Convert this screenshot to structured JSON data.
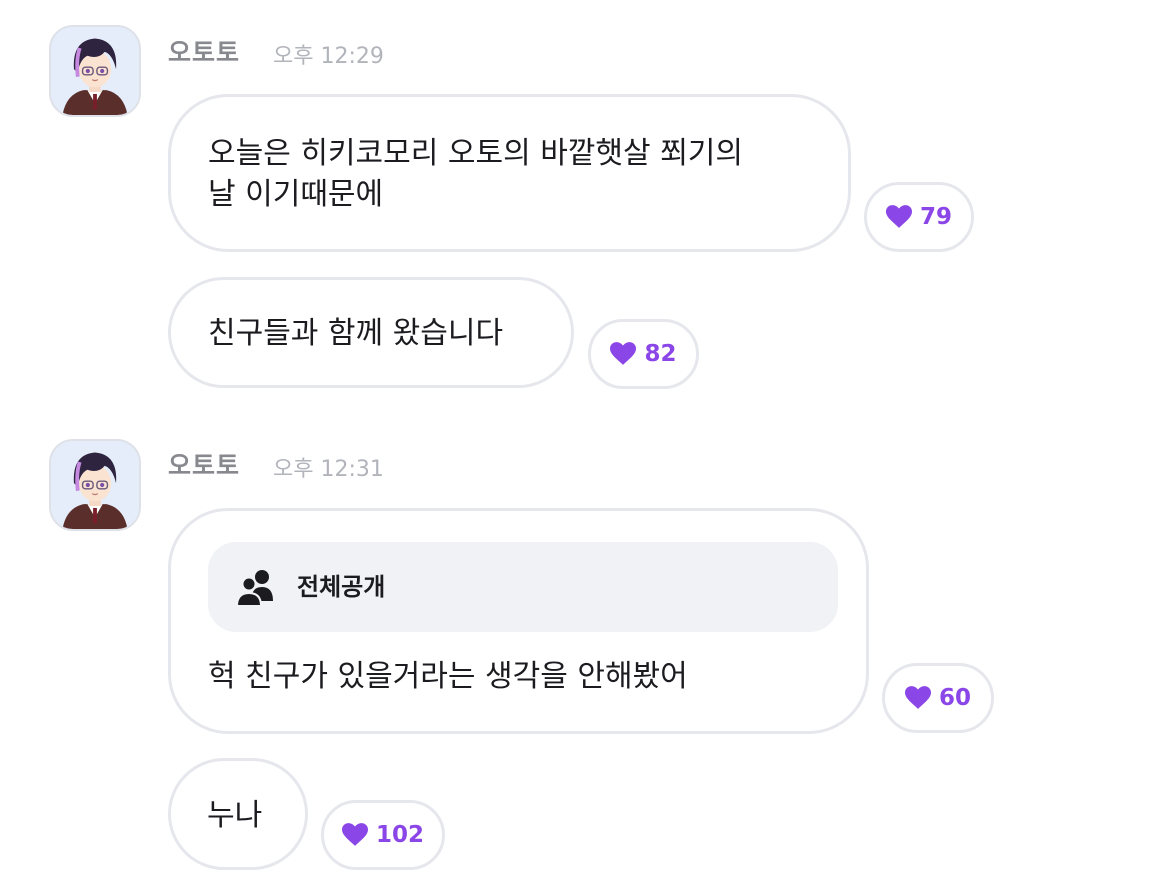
{
  "colors": {
    "accent": "#8b46e8",
    "bubble_border": "#e6e7ec",
    "sender_name": "#88898f",
    "timestamp": "#b2b4bb"
  },
  "message_groups": [
    {
      "sender": "오토토",
      "time": "오후 12:29",
      "avatar": "avatar-icon",
      "messages": [
        {
          "text": "오늘은 히키코모리 오토의 바깥햇살 쬐기의\n날 이기때문에",
          "likes": "79",
          "like_icon": "heart-icon"
        },
        {
          "text": "친구들과 함께 왔습니다",
          "likes": "82",
          "like_icon": "heart-icon"
        }
      ]
    },
    {
      "sender": "오토토",
      "time": "오후 12:31",
      "avatar": "avatar-icon",
      "messages": [
        {
          "visibility_icon": "people-icon",
          "visibility_label": "전체공개",
          "text": "헉 친구가 있을거라는 생각을 안해봤어",
          "likes": "60",
          "like_icon": "heart-icon"
        },
        {
          "text": "누나",
          "likes": "102",
          "like_icon": "heart-icon"
        }
      ]
    }
  ]
}
